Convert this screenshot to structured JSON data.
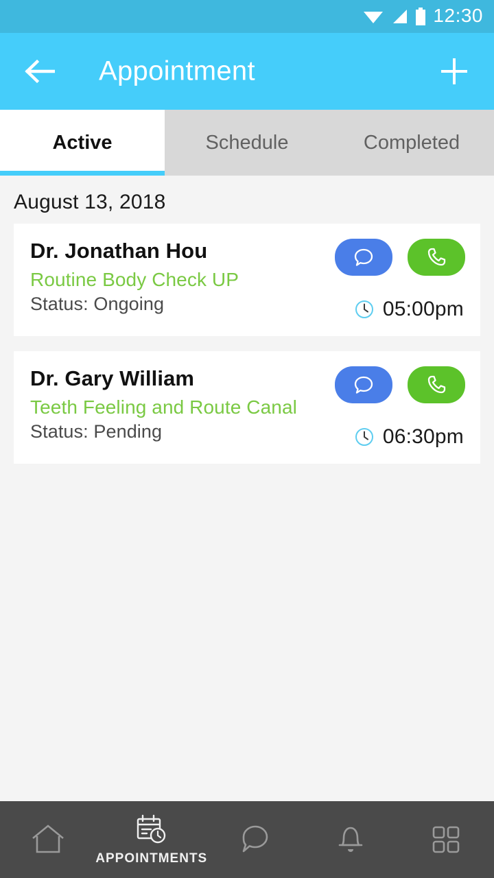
{
  "status_bar": {
    "time": "12:30",
    "icons": [
      "wifi-icon",
      "cellular-signal-icon",
      "battery-icon"
    ]
  },
  "app_bar": {
    "title": "Appointment",
    "back_icon": "back-arrow-icon",
    "add_icon": "plus-icon"
  },
  "tabs": [
    {
      "label": "Active",
      "active": true
    },
    {
      "label": "Schedule",
      "active": false
    },
    {
      "label": "Completed",
      "active": false
    }
  ],
  "content": {
    "date_header": "August 13, 2018",
    "appointments": [
      {
        "doctor": "Dr. Jonathan Hou",
        "service": "Routine Body Check UP",
        "status": "Status: Ongoing",
        "time": "05:00pm",
        "chat_icon": "chat-bubble-icon",
        "call_icon": "phone-icon",
        "clock_icon": "clock-icon"
      },
      {
        "doctor": "Dr. Gary William",
        "service": "Teeth Feeling and Route Canal",
        "status": "Status: Pending",
        "time": "06:30pm",
        "chat_icon": "chat-bubble-icon",
        "call_icon": "phone-icon",
        "clock_icon": "clock-icon"
      }
    ]
  },
  "bottom_nav": [
    {
      "icon": "home-icon",
      "label": "",
      "active": false
    },
    {
      "icon": "calendar-clock-icon",
      "label": "APPOINTMENTS",
      "active": true
    },
    {
      "icon": "chat-bubble-icon",
      "label": "",
      "active": false
    },
    {
      "icon": "bell-icon",
      "label": "",
      "active": false
    },
    {
      "icon": "grid-apps-icon",
      "label": "",
      "active": false
    }
  ],
  "colors": {
    "status_bar": "#3fb8de",
    "app_bar": "#45cdfa",
    "accent": "#45cdfa",
    "page_bg": "#f4f4f4",
    "tab_inactive_bg": "#d8d8d8",
    "service_green": "#7ac943",
    "chat_blue": "#4a7ee8",
    "call_green": "#5cc22a",
    "bottom_nav_bg": "#4a4a4a",
    "nav_inactive": "#9a9a9a"
  }
}
